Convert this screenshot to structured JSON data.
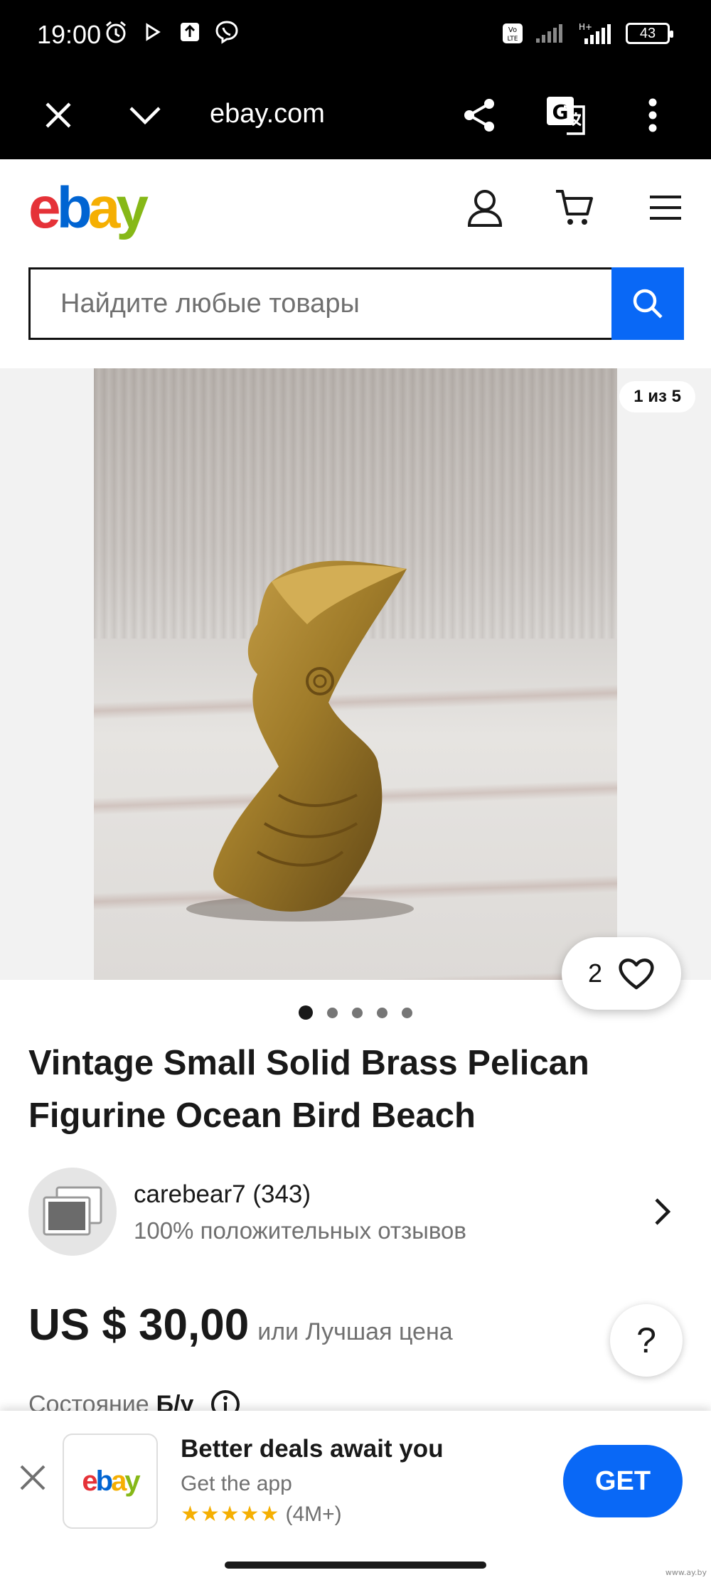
{
  "status_bar": {
    "time": "19:00",
    "battery": "43"
  },
  "browser": {
    "url": "ebay.com"
  },
  "header": {
    "logo_letters": [
      "e",
      "b",
      "a",
      "y"
    ],
    "logo_colors": [
      "#e53238",
      "#0064d2",
      "#f5af02",
      "#86b817"
    ]
  },
  "search": {
    "placeholder": "Найдите любые товары"
  },
  "gallery": {
    "counter": "1 из 5",
    "like_count": "2",
    "dots_total": 5,
    "dots_active": 1
  },
  "listing": {
    "title": "Vintage Small Solid Brass Pelican Figurine Ocean Bird Beach",
    "seller_name": "carebear7 (343)",
    "seller_feedback": "100% положительных отзывов",
    "price": "US $ 30,00",
    "best_offer": "или Лучшая цена",
    "condition_label": "Состояние",
    "condition_value": "Б/у",
    "help_label": "?"
  },
  "app_banner": {
    "logo_letters": [
      "e",
      "b",
      "a",
      "y"
    ],
    "title": "Better deals await you",
    "subtitle": "Get the app",
    "stars": "★★★★★",
    "rating_count": "(4M+)",
    "get_label": "GET"
  },
  "watermark": "www.ay.by",
  "colors": {
    "accent": "#0968f6",
    "star": "#f5af02"
  }
}
